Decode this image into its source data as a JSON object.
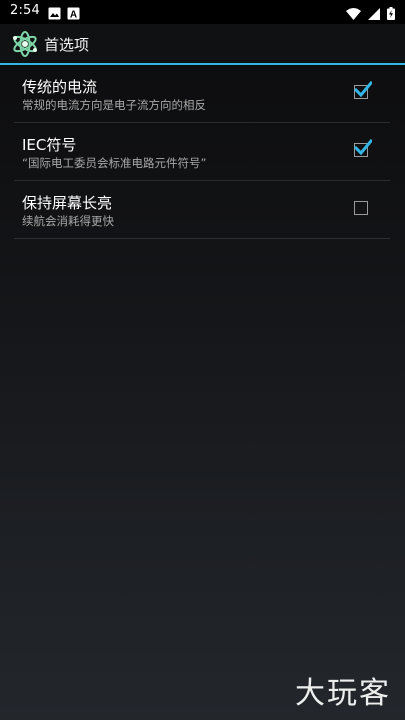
{
  "status_bar": {
    "time": "2:54",
    "left_icons": [
      "image-icon",
      "notification-a-icon"
    ],
    "right_icons": [
      "wifi-icon",
      "cellular-icon",
      "battery-charging-icon"
    ]
  },
  "action_bar": {
    "title": "首选项",
    "icon": "atom-app-icon",
    "accent_color": "#33b5e5"
  },
  "preferences": [
    {
      "title": "传统的电流",
      "summary": "常规的电流方向是电子流方向的相反",
      "checked": true
    },
    {
      "title": "IEC符号",
      "summary": "“国际电工委员会标准电路元件符号”",
      "checked": true
    },
    {
      "title": "保持屏幕长亮",
      "summary": "续航会消耗得更快",
      "checked": false
    }
  ],
  "watermark": "大玩客",
  "colors": {
    "check_accent": "#33b5e5",
    "summary_text": "#a8a8a8"
  }
}
